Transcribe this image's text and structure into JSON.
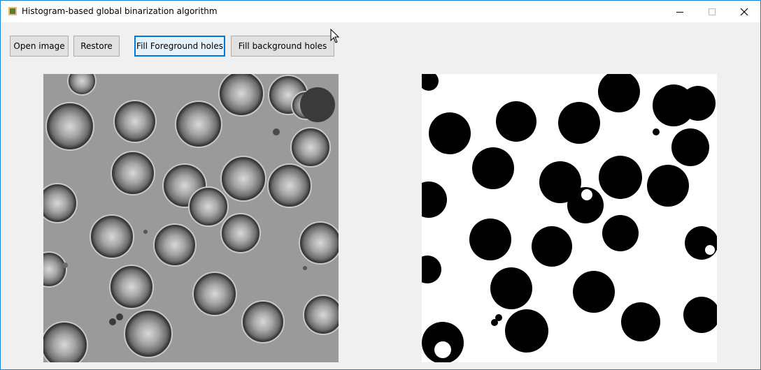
{
  "window": {
    "title": "Histogram-based global binarization algorithm",
    "icons": [
      "app-icon",
      "minimize-icon",
      "maximize-icon",
      "close-icon"
    ]
  },
  "toolbar": {
    "open_label": "Open image",
    "restore_label": "Restore",
    "fill_fg_label": "Fill Foreground holes",
    "fill_bg_label": "Fill background holes"
  },
  "images": {
    "original": "grayscale-blood-cells-image",
    "binary": "binarized-blood-cells-image"
  },
  "colors": {
    "accent": "#0078d7",
    "button_bg": "#e1e1e1",
    "window_bg": "#f0f0f0"
  }
}
